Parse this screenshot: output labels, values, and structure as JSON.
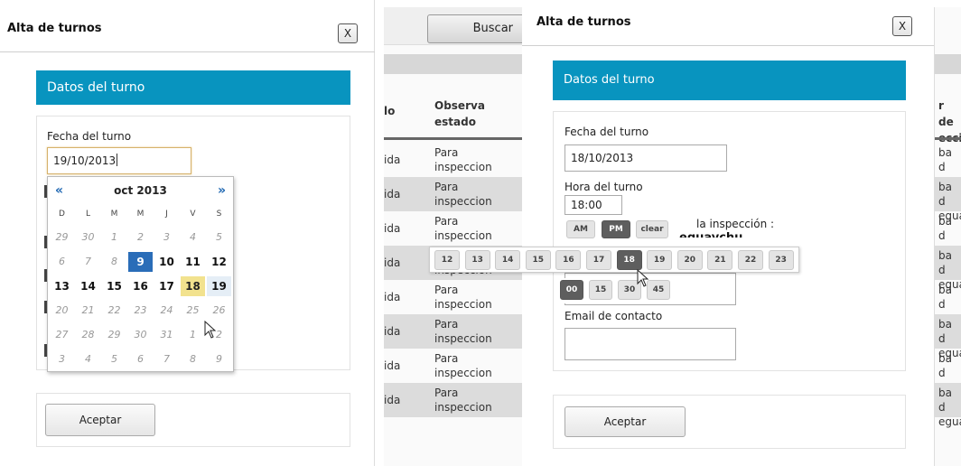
{
  "left_dialog": {
    "title": "Alta de turnos",
    "close_label": "X",
    "section_title": "Datos del turno",
    "fecha_label": "Fecha del turno",
    "fecha_value": "19/10/2013",
    "accept_label": "Aceptar",
    "calendar": {
      "prev": "«",
      "next": "»",
      "month": "oct 2013",
      "weekdays": [
        "D",
        "L",
        "M",
        "M",
        "J",
        "V",
        "S"
      ],
      "weeks": [
        [
          "29",
          "30",
          "1",
          "2",
          "3",
          "4",
          "5"
        ],
        [
          "6",
          "7",
          "8",
          "9",
          "10",
          "11",
          "12"
        ],
        [
          "13",
          "14",
          "15",
          "16",
          "17",
          "18",
          "19"
        ],
        [
          "20",
          "21",
          "22",
          "23",
          "24",
          "25",
          "26"
        ],
        [
          "27",
          "28",
          "29",
          "30",
          "31",
          "1",
          "2"
        ],
        [
          "3",
          "4",
          "5",
          "6",
          "7",
          "8",
          "9"
        ]
      ],
      "today": "9",
      "hovered": "18"
    }
  },
  "background": {
    "search_button": "Buscar",
    "col_left_header": "lo",
    "col_obs_header": "Observa estado",
    "rows": [
      {
        "c1": "ida",
        "c2": "Para inspeccion"
      },
      {
        "c1": "ida",
        "c2": "Para inspeccion"
      },
      {
        "c1": "ida",
        "c2": "Para inspeccion"
      },
      {
        "c1": "ida",
        "c2": "Para inspeccion"
      },
      {
        "c1": "ida",
        "c2": "Para inspeccion"
      },
      {
        "c1": "ida",
        "c2": "Para inspeccion"
      },
      {
        "c1": "ida",
        "c2": "Para inspeccion"
      },
      {
        "c1": "ida",
        "c2": "Para inspeccion"
      }
    ],
    "right_header": "r de ecci",
    "right_rows": [
      "ba d egua",
      "ba d egua",
      "ba d egua",
      "ba d egua",
      "ba d egua",
      "ba d egua",
      "ba d egua",
      "ba d egua"
    ]
  },
  "right_dialog": {
    "title": "Alta de turnos",
    "close_label": "X",
    "section_title": "Datos del turno",
    "fecha_label": "Fecha del turno",
    "fecha_value": "18/10/2013",
    "hora_label": "Hora del turno",
    "hora_value": "18:00",
    "ampm": [
      "AM",
      "PM"
    ],
    "ampm_selected": "PM",
    "clear_label": "clear",
    "inspeccion_label": "la inspección :",
    "inspeccion_value": "eguaychu",
    "hours": [
      "12",
      "13",
      "14",
      "15",
      "16",
      "17",
      "18",
      "19",
      "20",
      "21",
      "22",
      "23"
    ],
    "hour_selected": "18",
    "minutes": [
      "00",
      "15",
      "30",
      "45"
    ],
    "minute_selected": "00",
    "email_label": "Email de contacto",
    "accept_label": "Aceptar"
  }
}
